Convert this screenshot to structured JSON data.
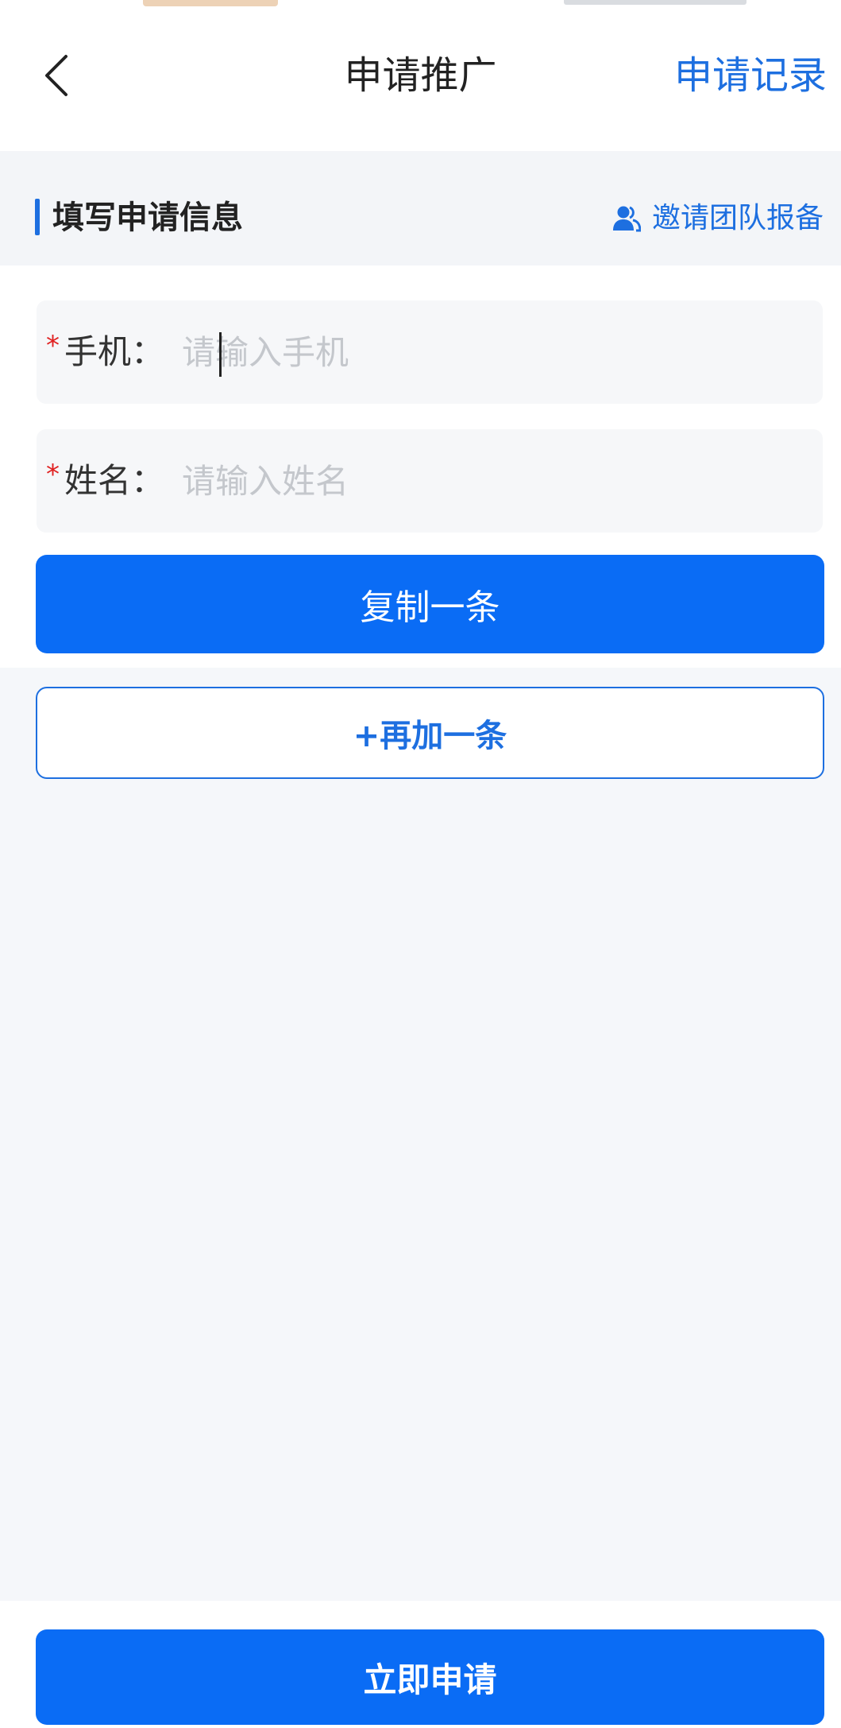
{
  "header": {
    "back_icon": "chevron-left-icon",
    "title": "申请推广",
    "record_link": "申请记录"
  },
  "section": {
    "title": "填写申请信息",
    "invite_icon": "users-icon",
    "invite_label": "邀请团队报备"
  },
  "form": {
    "phone": {
      "required_mark": "*",
      "label": "手机：",
      "placeholder": "请输入手机",
      "value": ""
    },
    "name": {
      "required_mark": "*",
      "label": "姓名：",
      "placeholder": "请输入姓名",
      "value": ""
    }
  },
  "actions": {
    "copy_label": "复制一条",
    "add_label": "+再加一条",
    "submit_label": "立即申请"
  },
  "colors": {
    "accent": "#1d6fe0",
    "primary_button": "#0a6cf5",
    "required": "#e02020",
    "background": "#f5f7fa"
  }
}
